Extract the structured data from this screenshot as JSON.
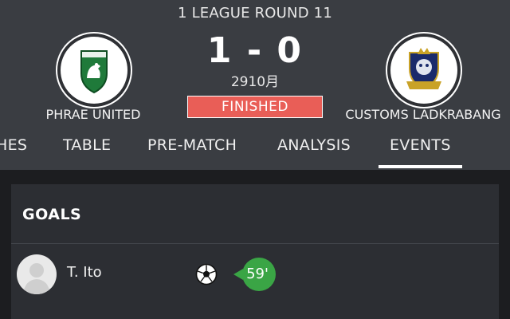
{
  "match": {
    "round": "1 LEAGUE ROUND 11",
    "home_team": "PHRAE UNITED",
    "away_team": "CUSTOMS LADKRABANG",
    "score": "1 - 0",
    "date": "2910月",
    "status": "FINISHED"
  },
  "tabs": [
    {
      "label": "HES"
    },
    {
      "label": "TABLE"
    },
    {
      "label": "PRE-MATCH"
    },
    {
      "label": "ANALYSIS"
    },
    {
      "label": "EVENTS",
      "active": true
    }
  ],
  "goals": {
    "title": "GOALS",
    "events": [
      {
        "player": "T. Ito",
        "minute": "59'",
        "icon": "football-icon"
      }
    ]
  },
  "colors": {
    "status_bg": "#e95e57",
    "minute_badge": "#3aa545",
    "header_bg": "#3a3d42",
    "card_bg": "#2c2e33"
  }
}
